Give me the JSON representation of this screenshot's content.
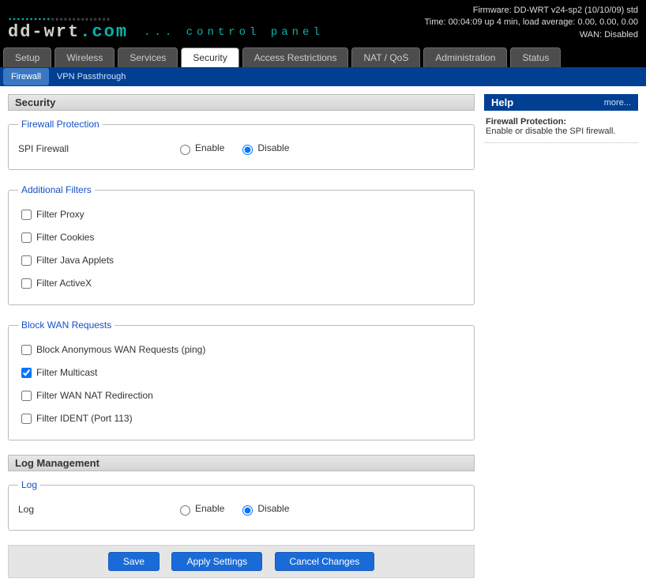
{
  "header": {
    "firmware": "Firmware: DD-WRT v24-sp2 (10/10/09) std",
    "time": "Time: 00:04:09 up 4 min, load average: 0.00, 0.00, 0.00",
    "wan": "WAN: Disabled",
    "logo1": "dd-wrt",
    "logo2": ".com",
    "cp": "... control panel"
  },
  "tabs": {
    "0": "Setup",
    "1": "Wireless",
    "2": "Services",
    "3": "Security",
    "4": "Access Restrictions",
    "5": "NAT / QoS",
    "6": "Administration",
    "7": "Status"
  },
  "subtabs": {
    "0": "Firewall",
    "1": "VPN Passthrough"
  },
  "sections": {
    "security": "Security",
    "logmgmt": "Log Management"
  },
  "fieldsets": {
    "firewall": {
      "legend": "Firewall Protection",
      "spi_label": "SPI Firewall",
      "enable": "Enable",
      "disable": "Disable"
    },
    "filters": {
      "legend": "Additional Filters",
      "proxy": "Filter Proxy",
      "cookies": "Filter Cookies",
      "java": "Filter Java Applets",
      "activex": "Filter ActiveX"
    },
    "wan": {
      "legend": "Block WAN Requests",
      "anon": "Block Anonymous WAN Requests (ping)",
      "multicast": "Filter Multicast",
      "nat": "Filter WAN NAT Redirection",
      "ident": "Filter IDENT (Port 113)"
    },
    "log": {
      "legend": "Log",
      "label": "Log",
      "enable": "Enable",
      "disable": "Disable"
    }
  },
  "buttons": {
    "save": "Save",
    "apply": "Apply Settings",
    "cancel": "Cancel Changes"
  },
  "help": {
    "title": "Help",
    "more": "more...",
    "heading": "Firewall Protection:",
    "body": "Enable or disable the SPI firewall."
  }
}
